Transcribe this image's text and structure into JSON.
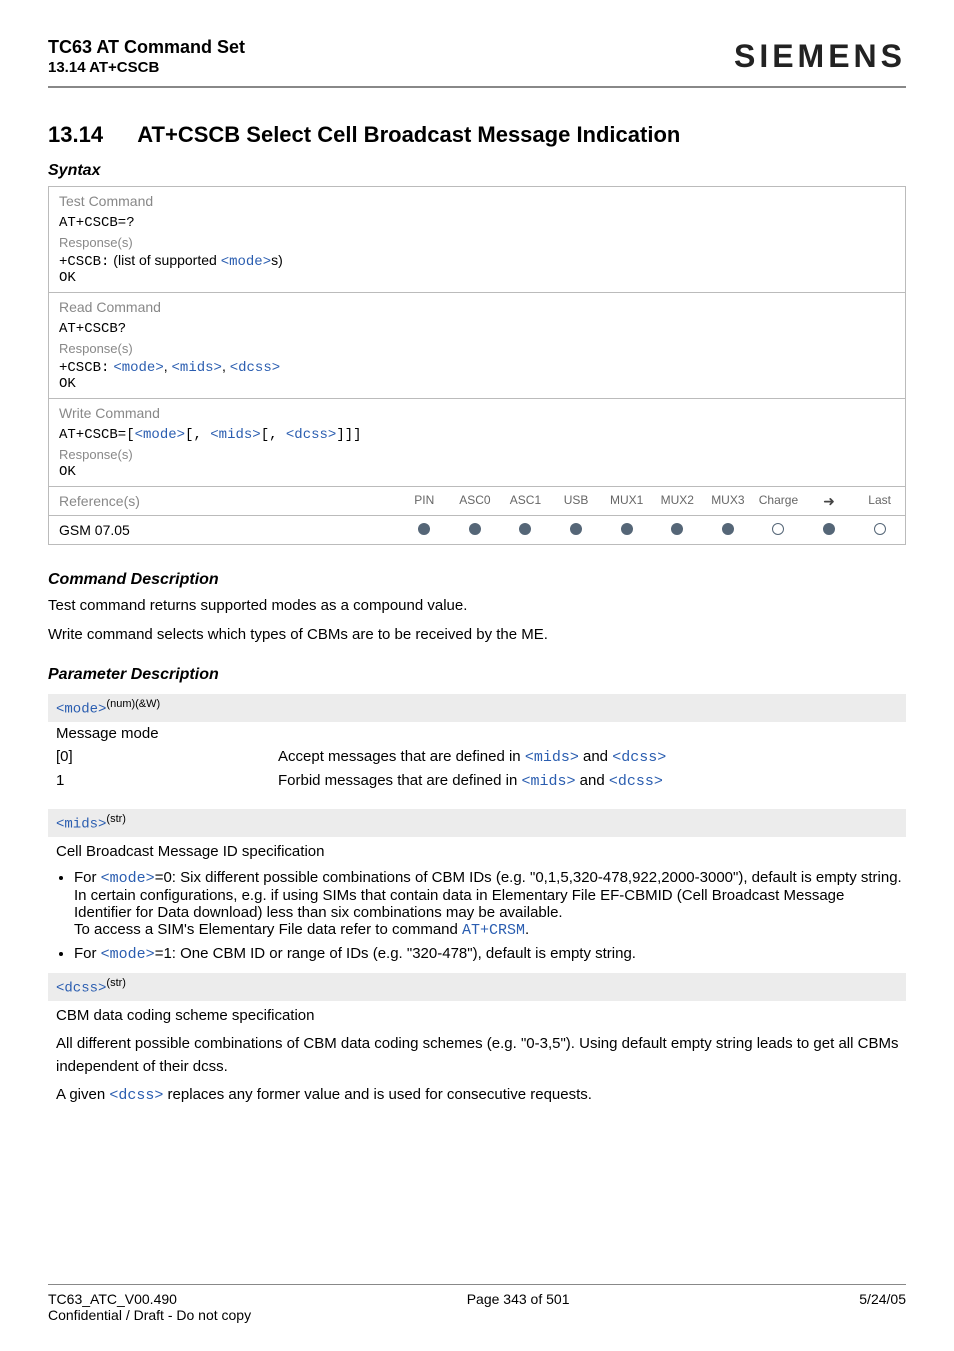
{
  "header": {
    "doc_title": "TC63 AT Command Set",
    "doc_subtitle": "13.14 AT+CSCB",
    "brand": "SIEMENS"
  },
  "section": {
    "number": "13.14",
    "title": "AT+CSCB   Select Cell Broadcast Message Indication"
  },
  "syntax": {
    "heading": "Syntax",
    "test": {
      "label": "Test Command",
      "cmd": "AT+CSCB=?",
      "resp_label": "Response(s)",
      "resp_prefix": "+CSCB:",
      "resp_text_before": " (list of supported ",
      "resp_mode": "<mode>",
      "resp_text_after": "s)",
      "ok": "OK"
    },
    "read": {
      "label": "Read Command",
      "cmd": "AT+CSCB?",
      "resp_label": "Response(s)",
      "resp_prefix": "+CSCB:",
      "p_mode": "<mode>",
      "comma": ", ",
      "p_mids": "<mids>",
      "p_dcss": "<dcss>",
      "ok": "OK"
    },
    "write": {
      "label": "Write Command",
      "cmd_prefix": "AT+CSCB=[",
      "p_mode": "<mode>",
      "b1": "[, ",
      "p_mids": "<mids>",
      "b2": "[, ",
      "p_dcss": "<dcss>",
      "b_end": "]]]",
      "resp_label": "Response(s)",
      "ok": "OK"
    },
    "ref": {
      "label": "Reference(s)",
      "value": "GSM 07.05",
      "cols": [
        "PIN",
        "ASC0",
        "ASC1",
        "USB",
        "MUX1",
        "MUX2",
        "MUX3",
        "Charge",
        "➜",
        "Last"
      ],
      "dots": [
        "f",
        "f",
        "f",
        "f",
        "f",
        "f",
        "f",
        "o",
        "f",
        "o"
      ]
    }
  },
  "cmd_desc": {
    "heading": "Command Description",
    "p1": "Test command returns supported modes as a compound value.",
    "p2": "Write command selects which types of CBMs are to be received by the ME."
  },
  "param_desc": {
    "heading": "Parameter Description",
    "mode": {
      "name": "<mode>",
      "sup": "(num)(&W)",
      "title": "Message mode",
      "row0_key": "[0]",
      "row0_txt_a": "Accept messages that are defined in ",
      "row0_mids": "<mids>",
      "row0_and": " and ",
      "row0_dcss": "<dcss>",
      "row1_key": "1",
      "row1_txt_a": "Forbid messages that are defined in ",
      "row1_mids": "<mids>",
      "row1_and": " and ",
      "row1_dcss": "<dcss>"
    },
    "mids": {
      "name": "<mids>",
      "sup": "(str)",
      "title": "Cell Broadcast Message ID specification",
      "b1_pre": "For ",
      "b1_mode": "<mode>",
      "b1_txt": "=0: Six different possible combinations of CBM IDs (e.g. \"0,1,5,320-478,922,2000-3000\"), default is empty string.",
      "b1_l2": "In certain configurations, e.g. if using SIMs that contain data in Elementary File EF-CBMID (Cell Broadcast Message Identifier for Data download) less than six combinations may be available.",
      "b1_l3_a": "To access a SIM's Elementary File data refer to command ",
      "b1_l3_link": "AT+CRSM",
      "b1_l3_b": ".",
      "b2_pre": "For ",
      "b2_mode": "<mode>",
      "b2_txt": "=1: One CBM ID or range of IDs (e.g. \"320-478\"), default is empty string."
    },
    "dcss": {
      "name": "<dcss>",
      "sup": "(str)",
      "title": "CBM data coding scheme specification",
      "p1": "All different possible combinations of CBM data coding schemes (e.g. \"0-3,5\"). Using default empty string leads to get all CBMs independent of their dcss.",
      "p2_a": "A given ",
      "p2_link": "<dcss>",
      "p2_b": " replaces any former value and is used for consecutive requests."
    }
  },
  "footer": {
    "left": "TC63_ATC_V00.490",
    "center": "Page 343 of 501",
    "right": "5/24/05",
    "conf": "Confidential / Draft - Do not copy"
  }
}
